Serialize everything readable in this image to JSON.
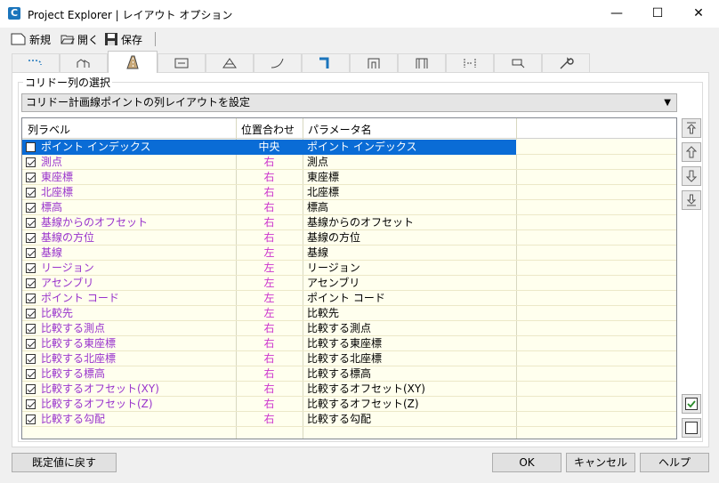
{
  "window": {
    "title": "Project Explorer | レイアウト オプション",
    "app_icon_letter": "C",
    "minimize": "—",
    "maximize": "☐",
    "close": "✕"
  },
  "toolbar": {
    "new_label": "新規",
    "open_label": "開く",
    "save_label": "保存"
  },
  "tabs": [
    {
      "icon": "alignment-icon",
      "active": false
    },
    {
      "icon": "profile-icon",
      "active": false
    },
    {
      "icon": "corridor-icon",
      "active": true
    },
    {
      "icon": "section-icon",
      "active": false
    },
    {
      "icon": "surface-icon",
      "active": false
    },
    {
      "icon": "curve-icon",
      "active": false
    },
    {
      "icon": "pipe-icon",
      "active": false
    },
    {
      "icon": "structure-icon",
      "active": false
    },
    {
      "icon": "structure-alt-icon",
      "active": false
    },
    {
      "icon": "dimension-icon",
      "active": false
    },
    {
      "icon": "point-icon",
      "active": false
    },
    {
      "icon": "settings-wrench-icon",
      "active": false
    }
  ],
  "group": {
    "label": "コリドー列の選択",
    "combo_value": "コリドー計画線ポイントの列レイアウトを設定"
  },
  "grid": {
    "headers": [
      "列ラベル",
      "位置合わせ",
      "パラメータ名"
    ],
    "rows": [
      {
        "checked": false,
        "label": "ポイント インデックス",
        "align": "中央",
        "param": "ポイント インデックス",
        "selected": true
      },
      {
        "checked": true,
        "label": "測点",
        "align": "右",
        "param": "測点"
      },
      {
        "checked": true,
        "label": "東座標",
        "align": "右",
        "param": "東座標"
      },
      {
        "checked": true,
        "label": "北座標",
        "align": "右",
        "param": "北座標"
      },
      {
        "checked": true,
        "label": "標高",
        "align": "右",
        "param": "標高"
      },
      {
        "checked": true,
        "label": "基線からのオフセット",
        "align": "右",
        "param": "基線からのオフセット"
      },
      {
        "checked": true,
        "label": "基線の方位",
        "align": "右",
        "param": "基線の方位"
      },
      {
        "checked": true,
        "label": "基線",
        "align": "左",
        "param": "基線"
      },
      {
        "checked": true,
        "label": "リージョン",
        "align": "左",
        "param": "リージョン"
      },
      {
        "checked": true,
        "label": "アセンブリ",
        "align": "左",
        "param": "アセンブリ"
      },
      {
        "checked": true,
        "label": "ポイント コード",
        "align": "左",
        "param": "ポイント コード"
      },
      {
        "checked": true,
        "label": "比較先",
        "align": "左",
        "param": "比較先"
      },
      {
        "checked": true,
        "label": "比較する測点",
        "align": "右",
        "param": "比較する測点"
      },
      {
        "checked": true,
        "label": "比較する東座標",
        "align": "右",
        "param": "比較する東座標"
      },
      {
        "checked": true,
        "label": "比較する北座標",
        "align": "右",
        "param": "比較する北座標"
      },
      {
        "checked": true,
        "label": "比較する標高",
        "align": "右",
        "param": "比較する標高"
      },
      {
        "checked": true,
        "label": "比較するオフセット(XY)",
        "align": "右",
        "param": "比較するオフセット(XY)"
      },
      {
        "checked": true,
        "label": "比較するオフセット(Z)",
        "align": "右",
        "param": "比較するオフセット(Z)"
      },
      {
        "checked": true,
        "label": "比較する勾配",
        "align": "右",
        "param": "比較する勾配"
      }
    ]
  },
  "buttons": {
    "reset": "既定値に戻す",
    "ok": "OK",
    "cancel": "キャンセル",
    "help": "ヘルプ"
  },
  "colors": {
    "selection": "#0a6cd6",
    "label_text": "#9933cc",
    "align_text": "#cc33cc",
    "grid_background": "#ffffee"
  }
}
